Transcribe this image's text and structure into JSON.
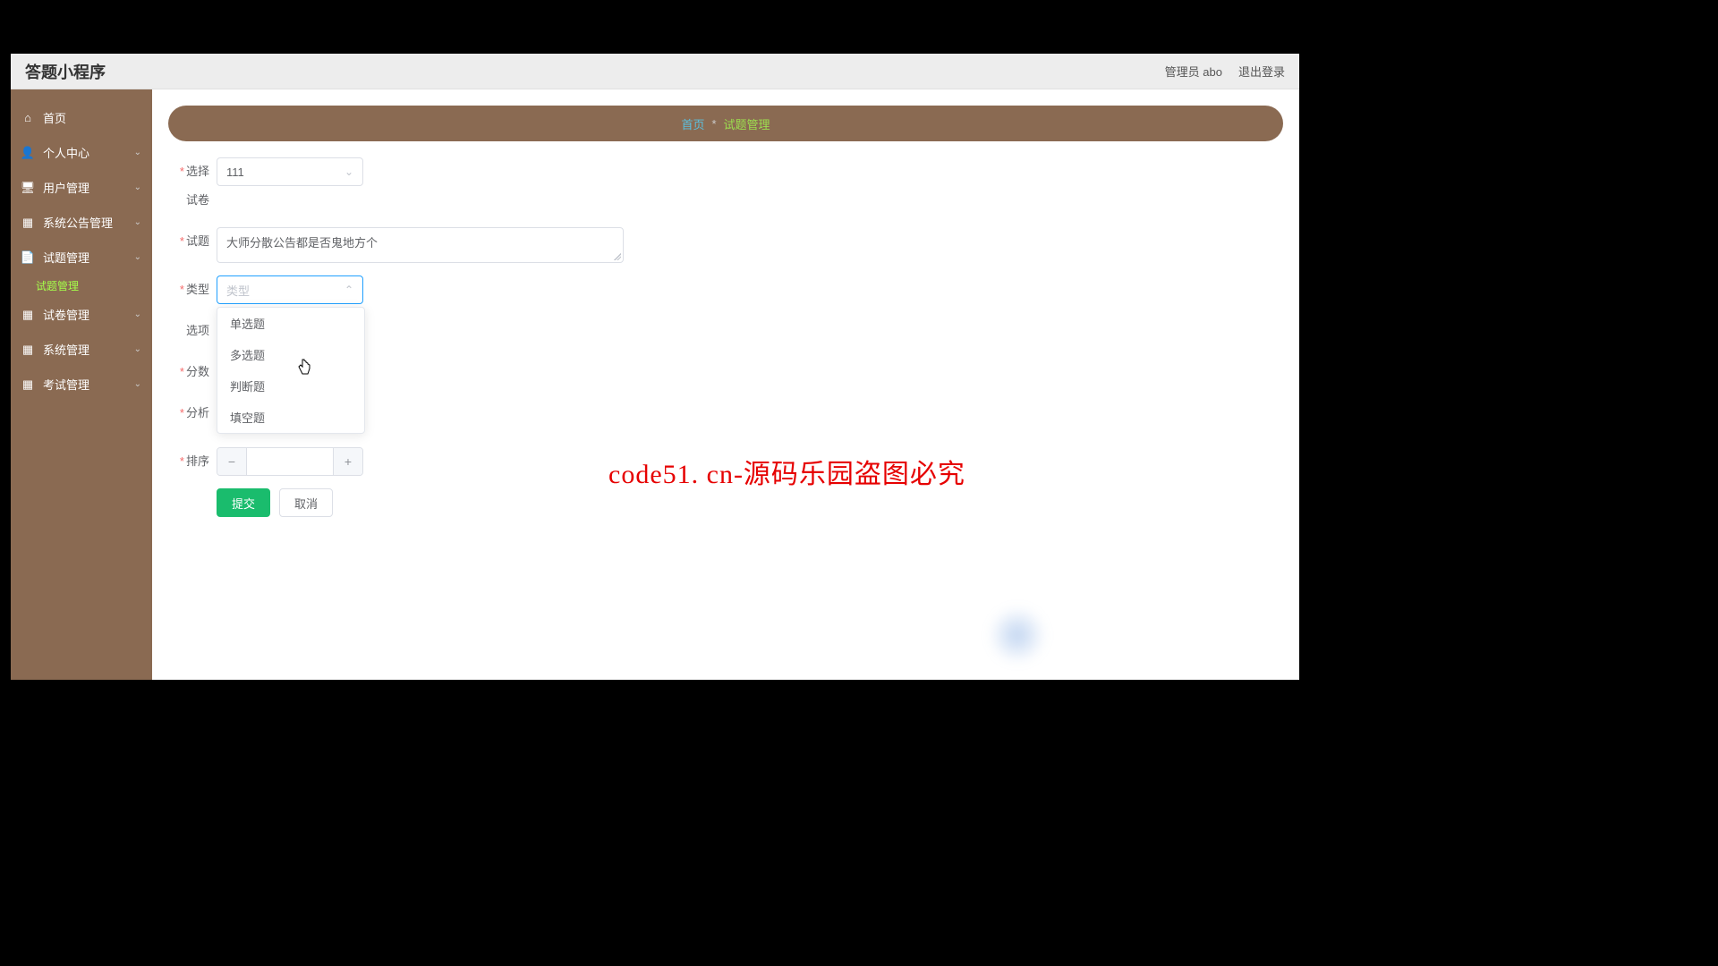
{
  "header": {
    "title": "答题小程序",
    "admin_label": "管理员 abo",
    "logout_label": "退出登录"
  },
  "sidebar": {
    "items": [
      {
        "label": "首页",
        "icon": "home"
      },
      {
        "label": "个人中心",
        "icon": "user",
        "expandable": true
      },
      {
        "label": "用户管理",
        "icon": "monitor",
        "expandable": true
      },
      {
        "label": "系统公告管理",
        "icon": "grid",
        "expandable": true
      },
      {
        "label": "试题管理",
        "icon": "doc",
        "expandable": true,
        "active": true,
        "sub": "试题管理"
      },
      {
        "label": "试卷管理",
        "icon": "grid",
        "expandable": true
      },
      {
        "label": "系统管理",
        "icon": "grid",
        "expandable": true
      },
      {
        "label": "考试管理",
        "icon": "grid",
        "expandable": true
      }
    ]
  },
  "breadcrumb": {
    "home": "首页",
    "sep": "*",
    "current": "试题管理"
  },
  "form": {
    "fields": {
      "paper": {
        "label": "选择试卷",
        "value": "111"
      },
      "question": {
        "label": "试题",
        "value": "大师分散公告都是否鬼地方个"
      },
      "type": {
        "label": "类型",
        "placeholder": "类型"
      },
      "options": {
        "label": "选项"
      },
      "score": {
        "label": "分数"
      },
      "analysis": {
        "label": "分析"
      },
      "sort": {
        "label": "排序",
        "value": ""
      }
    },
    "type_options": [
      "单选题",
      "多选题",
      "判断题",
      "填空题"
    ],
    "buttons": {
      "submit": "提交",
      "cancel": "取消"
    }
  },
  "overlay": {
    "watermark_text": "code51.cn",
    "banner": "code51. cn-源码乐园盗图必究"
  },
  "number_controls": {
    "minus": "−",
    "plus": "+"
  }
}
